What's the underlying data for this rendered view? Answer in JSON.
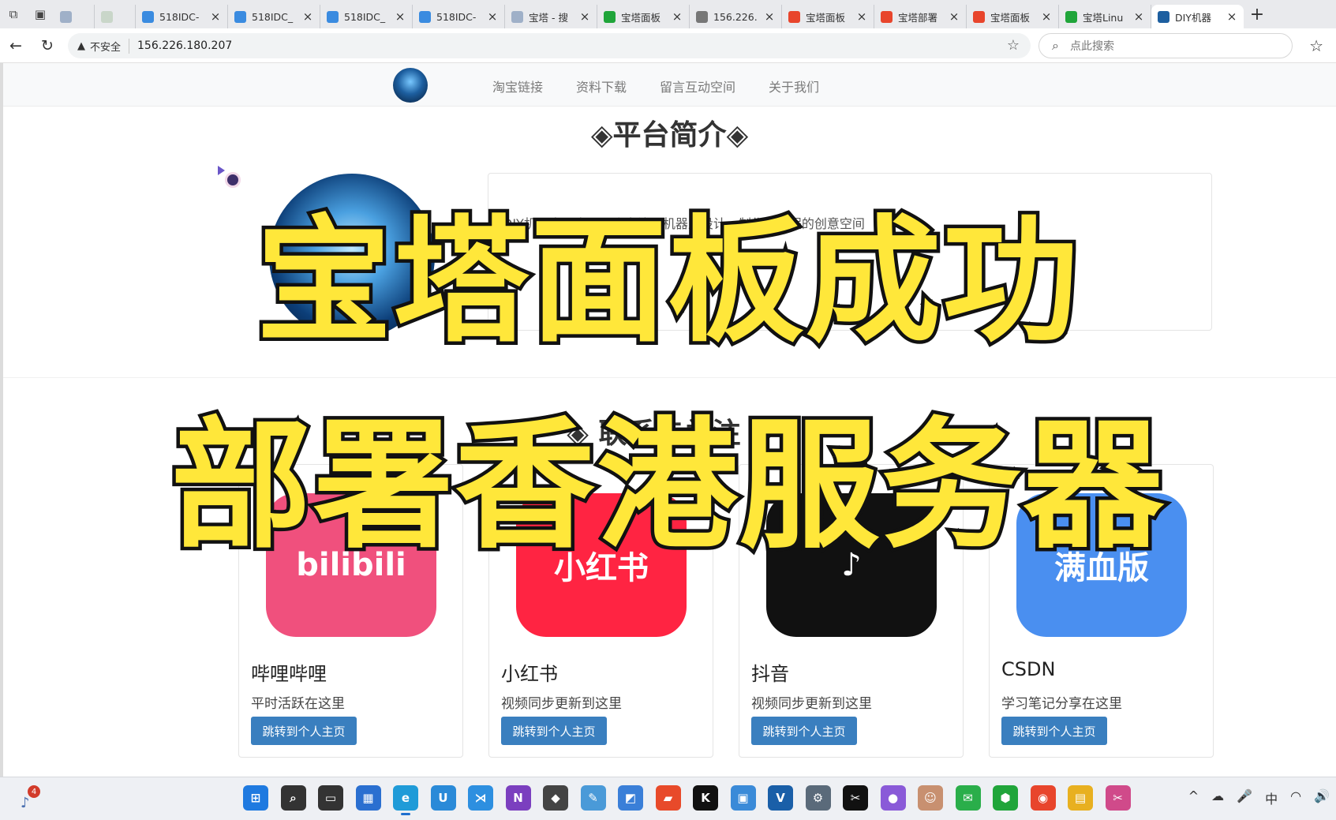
{
  "browser": {
    "tabs": [
      {
        "title": "",
        "favicon_color": "#9fb0c8",
        "small": true
      },
      {
        "title": "",
        "favicon_color": "#c9d6c9",
        "small": true
      },
      {
        "title": "518IDC-",
        "favicon_color": "#3a8be0"
      },
      {
        "title": "518IDC_",
        "favicon_color": "#3a8be0"
      },
      {
        "title": "518IDC_",
        "favicon_color": "#3a8be0"
      },
      {
        "title": "518IDC-",
        "favicon_color": "#3a8be0"
      },
      {
        "title": "宝塔 - 搜",
        "favicon_color": "#9fb0c8"
      },
      {
        "title": "宝塔面板",
        "favicon_color": "#20a53a"
      },
      {
        "title": "156.226.",
        "favicon_color": "#777777"
      },
      {
        "title": "宝塔面板",
        "favicon_color": "#e8452c"
      },
      {
        "title": "宝塔部署",
        "favicon_color": "#e8452c"
      },
      {
        "title": "宝塔面板",
        "favicon_color": "#e8452c"
      },
      {
        "title": "宝塔Linu",
        "favicon_color": "#20a53a"
      },
      {
        "title": "DIY机器",
        "favicon_color": "#1d5fa0",
        "active": true
      }
    ],
    "insecure_label": "不安全",
    "url": "156.226.180.207",
    "search_placeholder": "点此搜索"
  },
  "site": {
    "nav_links": [
      "淘宝链接",
      "资料下载",
      "留言互动空间",
      "关于我们"
    ],
    "intro_title": "◈平台简介◈",
    "intro_lines": [
      "DIY机器人工房是一个专注于机器人设计、制作和编程的创意空间"
    ],
    "social_title": "◈ 联系与关注 ◈",
    "cards": [
      {
        "name": "哔哩哔哩",
        "desc": "平时活跃在这里",
        "button": "跳转到个人主页",
        "icon_text": "bilibili",
        "icon_color": "#f0507d"
      },
      {
        "name": "小红书",
        "desc": "视频同步更新到这里",
        "button": "跳转到个人主页",
        "icon_text": "小红书",
        "icon_color": "#ff2442"
      },
      {
        "name": "抖音",
        "desc": "视频同步更新到这里",
        "button": "跳转到个人主页",
        "icon_text": "♪",
        "icon_color": "#111111"
      },
      {
        "name": "CSDN",
        "desc": "学习笔记分享在这里",
        "button": "跳转到个人主页",
        "icon_text": "满血版",
        "icon_color": "#4a8ff0"
      }
    ]
  },
  "overlay": {
    "line1": "宝塔面板成功",
    "line2": "部署香港服务器"
  },
  "taskbar": {
    "notification_count": "4",
    "apps": [
      {
        "name": "start-icon",
        "glyph": "⊞",
        "color": "#1f7ae0"
      },
      {
        "name": "search-icon",
        "glyph": "⌕",
        "color": "#333333"
      },
      {
        "name": "task-view-icon",
        "glyph": "▭",
        "color": "#333333"
      },
      {
        "name": "store-icon",
        "glyph": "▦",
        "color": "#2a6fd0"
      },
      {
        "name": "edge-icon",
        "glyph": "e",
        "color": "#1f9bd8",
        "active": true
      },
      {
        "name": "app-icon",
        "glyph": "U",
        "color": "#2a8ad8"
      },
      {
        "name": "vscode-icon",
        "glyph": "⋊",
        "color": "#2d8fe0"
      },
      {
        "name": "onenote-icon",
        "glyph": "N",
        "color": "#7b3fbf"
      },
      {
        "name": "box-icon",
        "glyph": "◆",
        "color": "#444444"
      },
      {
        "name": "paint-icon",
        "glyph": "✎",
        "color": "#4a9ad8"
      },
      {
        "name": "app-icon-2",
        "glyph": "◩",
        "color": "#3a7fd8"
      },
      {
        "name": "app-icon-3",
        "glyph": "▰",
        "color": "#e84a2a"
      },
      {
        "name": "k-icon",
        "glyph": "K",
        "color": "#111111"
      },
      {
        "name": "photo-icon",
        "glyph": "▣",
        "color": "#3a8ad8"
      },
      {
        "name": "v-icon",
        "glyph": "V",
        "color": "#1a5fa8"
      },
      {
        "name": "settings-icon",
        "glyph": "⚙",
        "color": "#5a6a7a"
      },
      {
        "name": "capcut-icon",
        "glyph": "✂",
        "color": "#111111"
      },
      {
        "name": "nest-icon",
        "glyph": "●",
        "color": "#8a5ad8"
      },
      {
        "name": "avatar-icon",
        "glyph": "☺",
        "color": "#c89070"
      },
      {
        "name": "wechat-icon",
        "glyph": "✉",
        "color": "#2aae4a"
      },
      {
        "name": "bt-shield-icon",
        "glyph": "⬢",
        "color": "#20a53a"
      },
      {
        "name": "chrome-icon",
        "glyph": "◉",
        "color": "#e8452c"
      },
      {
        "name": "folder-icon",
        "glyph": "▤",
        "color": "#e8b020"
      },
      {
        "name": "snip-icon",
        "glyph": "✂",
        "color": "#d04a8a"
      }
    ],
    "tray": [
      "^",
      "☁",
      "🎤",
      "中",
      "◠",
      "🔊"
    ]
  }
}
